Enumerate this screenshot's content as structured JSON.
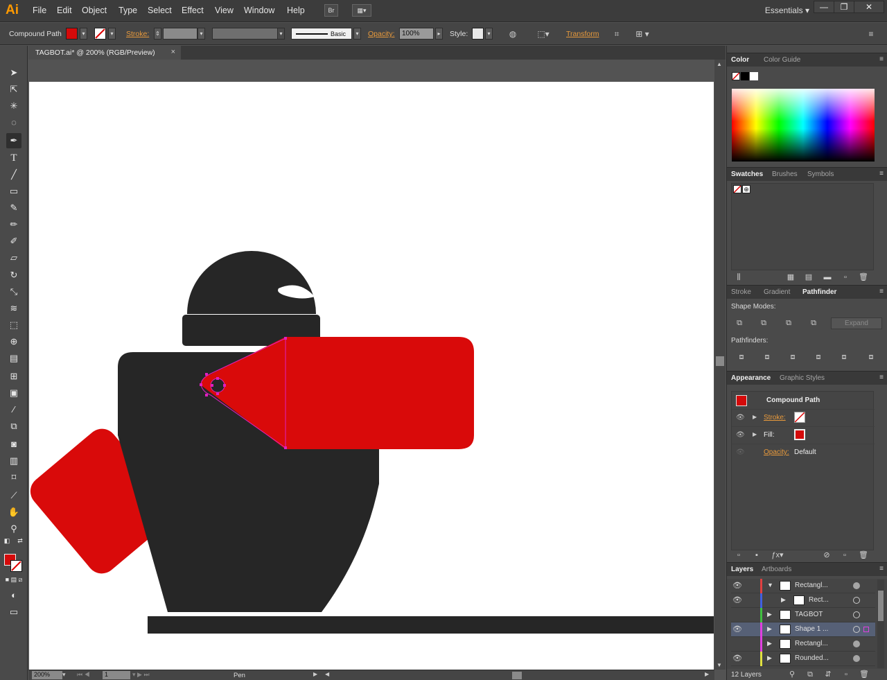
{
  "app": {
    "logo": "Ai"
  },
  "menu": [
    "File",
    "Edit",
    "Object",
    "Type",
    "Select",
    "Effect",
    "View",
    "Window",
    "Help"
  ],
  "menu_buttons": {
    "bridge": "Br"
  },
  "workspace": {
    "label": "Essentials"
  },
  "window_controls": {
    "minimize": "—",
    "restore": "❐",
    "close": "✕"
  },
  "control": {
    "selection_type": "Compound Path",
    "fill_color": "#d40a0a",
    "stroke_label": "Stroke:",
    "brush_label": "Basic",
    "opacity_label": "Opacity:",
    "opacity_value": "100%",
    "style_label": "Style:",
    "transform_label": "Transform"
  },
  "document": {
    "tab_title": "TAGBOT.ai* @ 200% (RGB/Preview)",
    "tab_close": "×"
  },
  "status": {
    "zoom": "200%",
    "artboard_num": "1",
    "tool": "Pen"
  },
  "panels": {
    "color_tabs": [
      "Color",
      "Color Guide"
    ],
    "swatch_tabs": [
      "Swatches",
      "Brushes",
      "Symbols"
    ],
    "pathfinder_tabs": [
      "Stroke",
      "Gradient",
      "Pathfinder"
    ],
    "shape_modes_label": "Shape Modes:",
    "expand_label": "Expand",
    "pathfinders_label": "Pathfinders:",
    "appearance_tabs": [
      "Appearance",
      "Graphic Styles"
    ],
    "appearance": {
      "title": "Compound Path",
      "stroke_label": "Stroke:",
      "fill_label": "Fill:",
      "opacity_label": "Opacity:",
      "opacity_value": "Default"
    },
    "layers_tabs": [
      "Layers",
      "Artboards"
    ],
    "layers": [
      {
        "name": "Rectangl...",
        "color": "#e04040",
        "expanded": true,
        "indent": false,
        "selected": false
      },
      {
        "name": "Rect...",
        "color": "#4060e0",
        "expanded": false,
        "indent": true,
        "selected": false
      },
      {
        "name": "TAGBOT",
        "color": "#40c040",
        "expanded": false,
        "indent": false,
        "selected": false
      },
      {
        "name": "Shape 1 ...",
        "color": "#e040e0",
        "expanded": false,
        "indent": false,
        "selected": true
      },
      {
        "name": "Rectangl...",
        "color": "#e040e0",
        "expanded": false,
        "indent": false,
        "selected": false
      },
      {
        "name": "Rounded...",
        "color": "#e0e040",
        "expanded": false,
        "indent": false,
        "selected": false
      }
    ],
    "layers_count": "12 Layers"
  },
  "colors": {
    "robot_dark": "#262626",
    "tag_red": "#d90a0a",
    "path_magenta": "#e020c0",
    "panel_bg": "#4a4a4a",
    "accent_orange": "#ff9a00"
  }
}
